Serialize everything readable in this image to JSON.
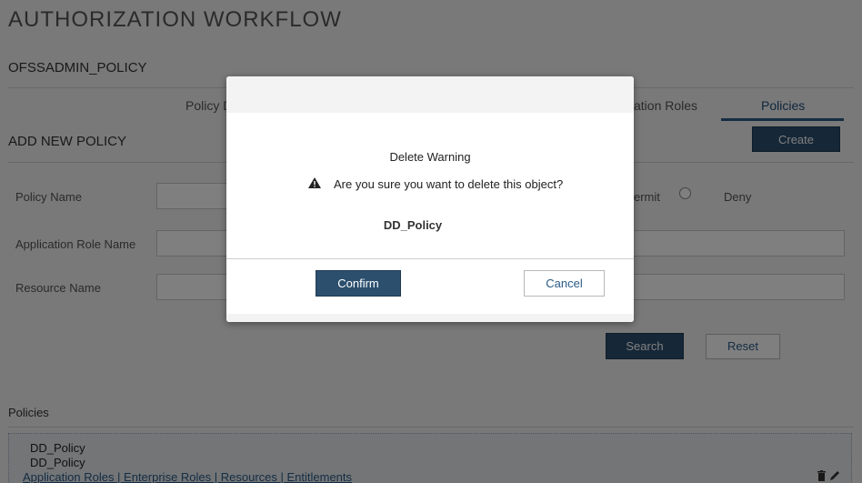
{
  "page": {
    "title": "AUTHORIZATION WORKFLOW",
    "policy_heading": "OFSSADMIN_POLICY"
  },
  "tabs": {
    "policy_details": "Policy D",
    "application_roles": "ation Roles",
    "policies": "Policies"
  },
  "form": {
    "section_title": "ADD NEW POLICY",
    "create_label": "Create",
    "policy_name_label": "Policy Name",
    "application_role_name_label": "Application Role Name",
    "resource_name_label": "Resource Name",
    "permit_label": "ermit",
    "deny_label": "Deny",
    "search_label": "Search",
    "reset_label": "Reset"
  },
  "policies_list": {
    "title": "Policies",
    "row_name": "DD_Policy",
    "row_description": "DD_Policy",
    "links": "Application Roles | Enterprise Roles | Resources | Entitlements",
    "actions_icons": [
      "trash-icon",
      "pencil-icon"
    ]
  },
  "dialog": {
    "heading": "Delete Warning",
    "message": "Are you sure you want to delete this object?",
    "object_name": "DD_Policy",
    "confirm_label": "Confirm",
    "cancel_label": "Cancel",
    "icon": "warning-triangle-icon"
  },
  "colors": {
    "primary_button": "#2c4f6e",
    "link": "#2a5b87",
    "overlay": "rgba(0,0,0,0.5)"
  }
}
